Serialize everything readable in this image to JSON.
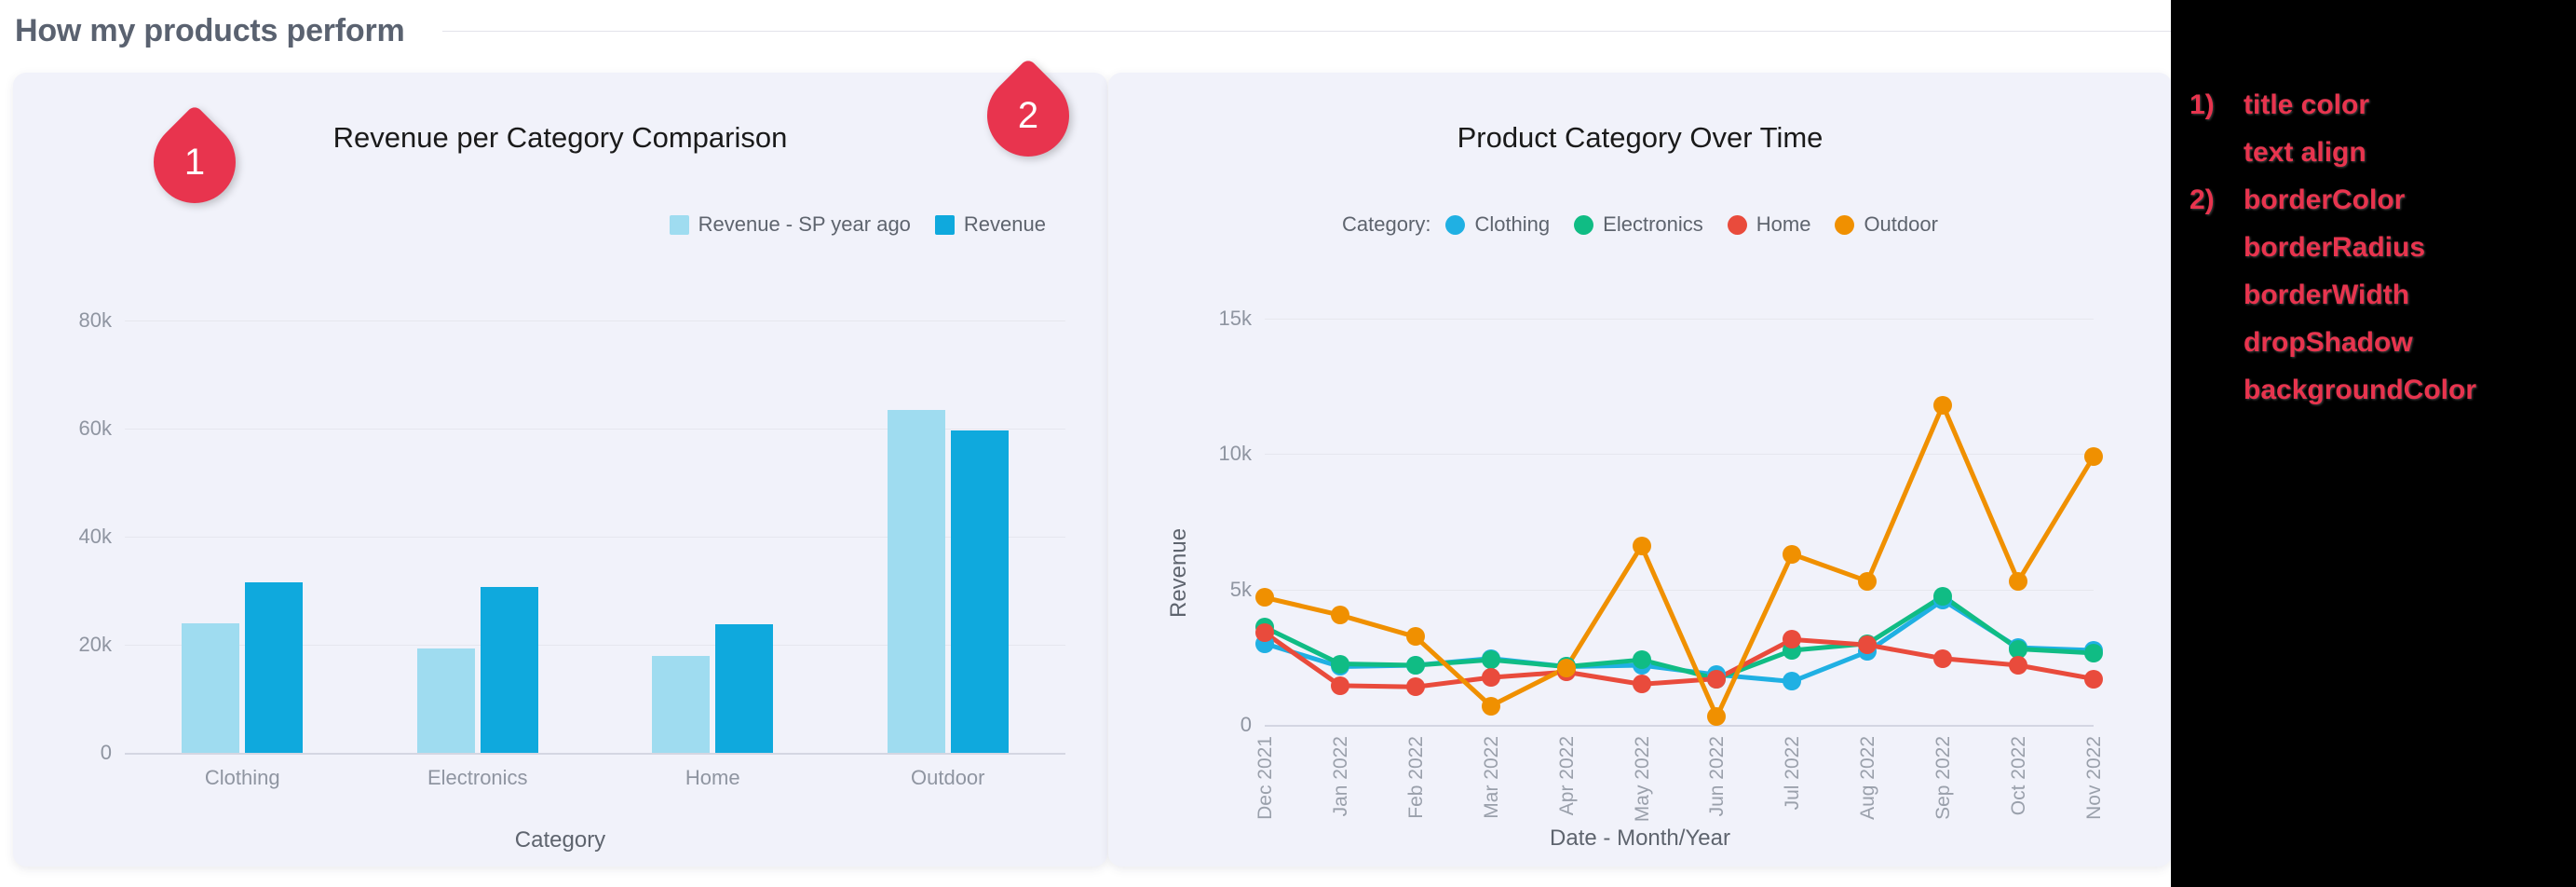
{
  "header": {
    "title": "How my products perform"
  },
  "markers": [
    {
      "id": "1",
      "label": "1"
    },
    {
      "id": "2",
      "label": "2"
    }
  ],
  "bar_card": {
    "title": "Revenue per Category Comparison",
    "legend": [
      {
        "label": "Revenue - SP year ago",
        "color": "#9fdcf0"
      },
      {
        "label": "Revenue",
        "color": "#0fa9dd"
      }
    ]
  },
  "line_card": {
    "title": "Product Category Over Time",
    "legend_prefix": "Category:",
    "legend": [
      {
        "label": "Clothing",
        "color": "#20b0e3"
      },
      {
        "label": "Electronics",
        "color": "#10bc84"
      },
      {
        "label": "Home",
        "color": "#e94b3c"
      },
      {
        "label": "Outdoor",
        "color": "#f09000"
      }
    ]
  },
  "notes": {
    "title": "annotation-notes",
    "rows": [
      {
        "idx": "1)",
        "text": "title color"
      },
      {
        "idx": "",
        "text": "text align"
      },
      {
        "idx": "2)",
        "text": "borderColor"
      },
      {
        "idx": "",
        "text": "borderRadius"
      },
      {
        "idx": "",
        "text": "borderWidth"
      },
      {
        "idx": "",
        "text": "dropShadow"
      },
      {
        "idx": "",
        "text": "backgroundColor"
      }
    ]
  },
  "chart_data": [
    {
      "type": "bar",
      "title": "Revenue per Category Comparison",
      "xlabel": "Category",
      "ylabel": "",
      "categories": [
        "Clothing",
        "Electronics",
        "Home",
        "Outdoor"
      ],
      "ytick_labels": [
        "0",
        "20k",
        "40k",
        "60k",
        "80k"
      ],
      "ytick_values": [
        0,
        20000,
        40000,
        60000,
        80000
      ],
      "ylim": [
        0,
        88000
      ],
      "grid": true,
      "legend_position": "top-right",
      "series": [
        {
          "name": "Revenue - SP year ago",
          "color": "#9fdcf0",
          "values": [
            24000,
            19300,
            18000,
            63500
          ]
        },
        {
          "name": "Revenue",
          "color": "#0fa9dd",
          "values": [
            31500,
            30800,
            23800,
            59700
          ]
        }
      ]
    },
    {
      "type": "line",
      "title": "Product Category Over Time",
      "xlabel": "Date - Month/Year",
      "ylabel": "Revenue",
      "x": [
        "Dec 2021",
        "Jan 2022",
        "Feb 2022",
        "Mar 2022",
        "Apr 2022",
        "May 2022",
        "Jun 2022",
        "Jul 2022",
        "Aug 2022",
        "Sep 2022",
        "Oct 2022",
        "Nov 2022"
      ],
      "ytick_labels": [
        "0",
        "5k",
        "10k",
        "15k"
      ],
      "ytick_values": [
        0,
        5000,
        10000,
        15000
      ],
      "ylim": [
        0,
        16500
      ],
      "grid": true,
      "legend_position": "top-center",
      "series": [
        {
          "name": "Clothing",
          "color": "#20b0e3",
          "values": [
            3000,
            2150,
            2200,
            2450,
            2150,
            2200,
            1850,
            1600,
            2700,
            4600,
            2850,
            2750
          ]
        },
        {
          "name": "Electronics",
          "color": "#10bc84",
          "values": [
            3600,
            2250,
            2200,
            2400,
            2150,
            2400,
            1700,
            2750,
            3000,
            4750,
            2800,
            2650
          ]
        },
        {
          "name": "Home",
          "color": "#e94b3c",
          "values": [
            3400,
            1450,
            1400,
            1750,
            1950,
            1500,
            1700,
            3150,
            2950,
            2450,
            2200,
            1700
          ]
        },
        {
          "name": "Outdoor",
          "color": "#f09000",
          "values": [
            4700,
            4050,
            3250,
            700,
            2100,
            6600,
            300,
            6300,
            5300,
            11800,
            5300,
            9900
          ]
        }
      ]
    }
  ]
}
